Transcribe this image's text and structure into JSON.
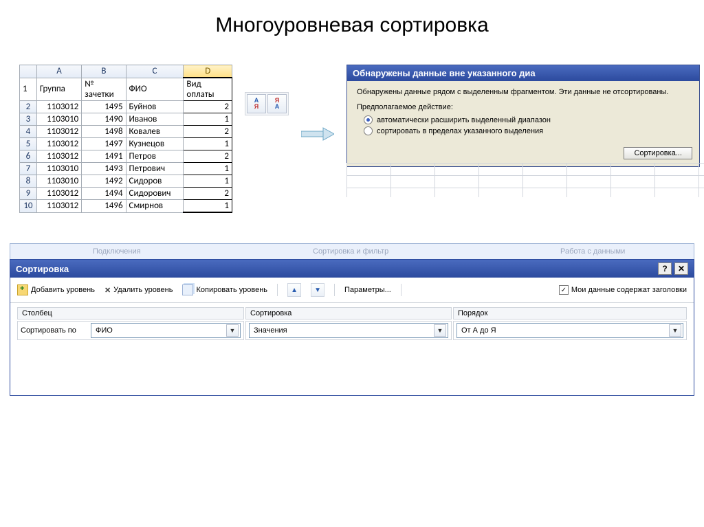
{
  "page_title": "Многоуровневая сортировка",
  "sheet": {
    "col_heads": [
      "A",
      "B",
      "C",
      "D"
    ],
    "row1": [
      "Группа",
      "№ зачетки",
      "ФИО",
      "Вид оплаты"
    ],
    "rows": [
      [
        "1103012",
        "1495",
        "Буйнов",
        "2"
      ],
      [
        "1103010",
        "1490",
        "Иванов",
        "1"
      ],
      [
        "1103012",
        "1498",
        "Ковалев",
        "2"
      ],
      [
        "1103012",
        "1497",
        "Кузнецов",
        "1"
      ],
      [
        "1103012",
        "1491",
        "Петров",
        "2"
      ],
      [
        "1103010",
        "1493",
        "Петрович",
        "1"
      ],
      [
        "1103010",
        "1492",
        "Сидоров",
        "1"
      ],
      [
        "1103012",
        "1494",
        "Сидорович",
        "2"
      ],
      [
        "1103012",
        "1496",
        "Смирнов",
        "1"
      ]
    ]
  },
  "sortbtn": {
    "asc_top": "А",
    "asc_bot": "Я",
    "desc_top": "Я",
    "desc_bot": "А"
  },
  "warn": {
    "title": "Обнаружены данные вне указанного диа",
    "text": "Обнаружены данные рядом с выделенным фрагментом. Эти данные не отсортированы.",
    "action_label": "Предполагаемое действие:",
    "opt1": "автоматически расширить выделенный диапазон",
    "opt2": "сортировать в пределах указанного выделения",
    "btn": "Сортировка..."
  },
  "ribbon": {
    "a": "Подключения",
    "b": "Сортировка и фильтр",
    "c": "Работа с данными"
  },
  "sortdlg": {
    "title": "Сортировка",
    "add": "Добавить уровень",
    "del": "Удалить уровень",
    "copy": "Копировать уровень",
    "params": "Параметры...",
    "has_headers": "Мои данные содержат заголовки",
    "head_col": "Столбец",
    "head_sort": "Сортировка",
    "head_order": "Порядок",
    "sort_by": "Сортировать по",
    "val_col": "ФИО",
    "val_sort": "Значения",
    "val_order": "От А до Я"
  }
}
